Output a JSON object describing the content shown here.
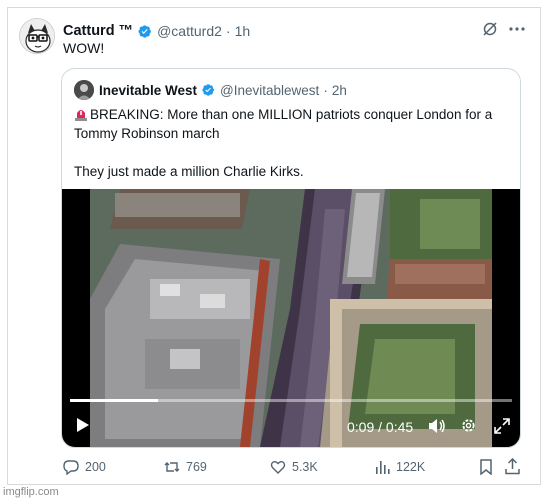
{
  "post": {
    "author_name": "Catturd ™",
    "handle": "@catturd2",
    "separator": "·",
    "time": "1h",
    "text": "WOW!",
    "icons": [
      "grok-icon",
      "more-icon"
    ]
  },
  "quote": {
    "author_name": "Inevitable West",
    "handle": "@Inevitablewest",
    "separator": "·",
    "time": "2h",
    "line1": "BREAKING: More than one MILLION patriots conquer London for a Tommy Robinson march",
    "line2": "They just made a million Charlie Kirks.",
    "video": {
      "elapsed_and_total": "0:09 / 0:45",
      "progress": 0.2
    }
  },
  "actions": {
    "replies": "200",
    "reposts": "769",
    "likes": "5.3K",
    "views": "122K"
  },
  "watermark": "imgflip.com",
  "colors": {
    "verified": "#1d9bf0",
    "text": "#0f1419",
    "muted": "#536471",
    "border": "#cfd9de"
  }
}
